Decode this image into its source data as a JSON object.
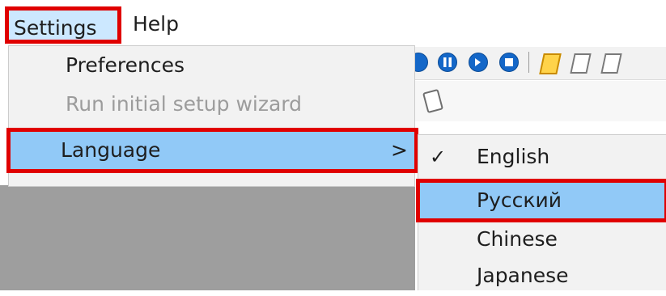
{
  "menubar": {
    "settings_label": "Settings",
    "help_label": "Help"
  },
  "settings_menu": {
    "preferences_label": "Preferences",
    "wizard_label": "Run initial setup wizard",
    "language_label": "Language",
    "language_arrow": ">"
  },
  "language_menu": {
    "items": [
      {
        "label": "English",
        "checked": true
      },
      {
        "label": "Русский",
        "checked": false,
        "hovered": true
      },
      {
        "label": "Chinese",
        "checked": false
      },
      {
        "label": "Japanese",
        "checked": false
      }
    ],
    "check_glyph": "✓"
  },
  "colors": {
    "highlight": "#91c9f7",
    "annotation_border": "#e00000",
    "menu_bg": "#f2f2f2",
    "disabled_text": "#9c9c9c",
    "toolbar_button": "#1467c8"
  },
  "icons": [
    "pause-icon",
    "next-icon",
    "stop-icon",
    "script-icon",
    "document-icon"
  ]
}
